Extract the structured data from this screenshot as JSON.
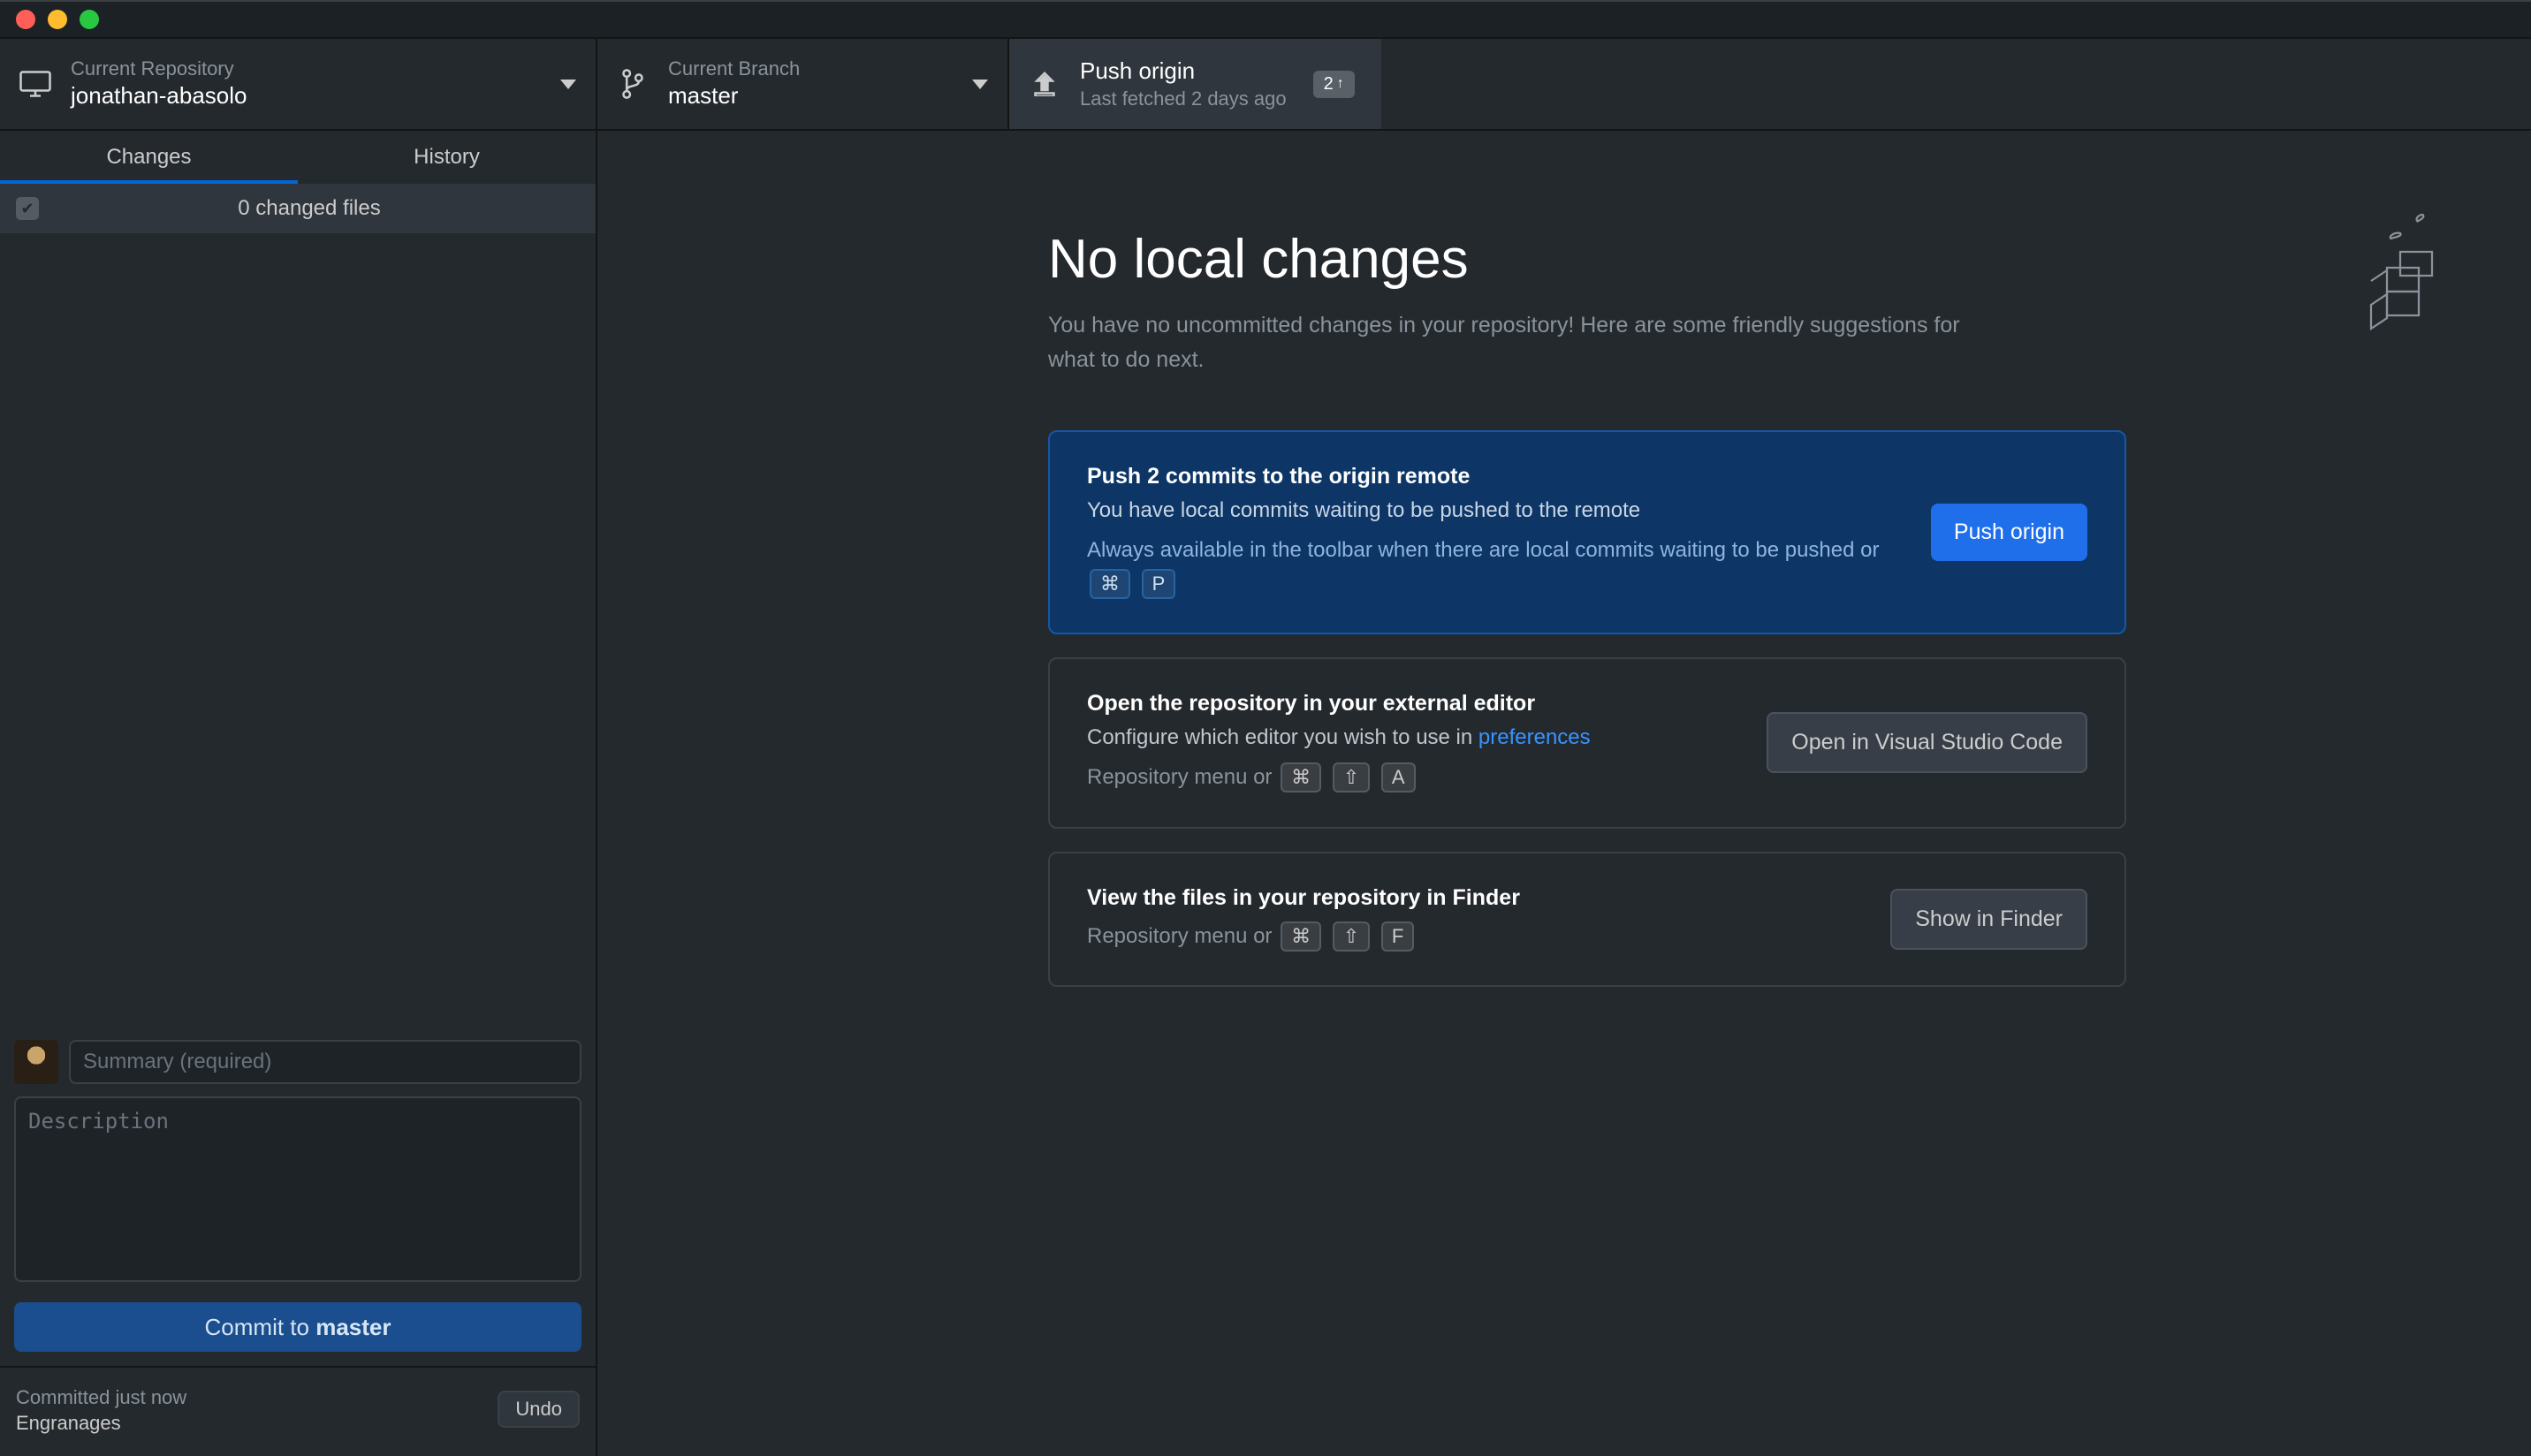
{
  "toolbar": {
    "repo_label": "Current Repository",
    "repo_name": "jonathan-abasolo",
    "branch_label": "Current Branch",
    "branch_name": "master",
    "push_label": "Push origin",
    "push_sub": "Last fetched 2 days ago",
    "push_badge_count": "2"
  },
  "sidebar": {
    "tab_changes": "Changes",
    "tab_history": "History",
    "changed_files": "0 changed files",
    "summary_placeholder": "Summary (required)",
    "description_placeholder": "Description",
    "commit_prefix": "Commit to ",
    "commit_branch": "master",
    "undo_line1": "Committed just now",
    "undo_line2": "Engranages",
    "undo_btn": "Undo"
  },
  "content": {
    "hero_title": "No local changes",
    "hero_sub": "You have no uncommitted changes in your repository! Here are some friendly suggestions for what to do next.",
    "cards": [
      {
        "title": "Push 2 commits to the origin remote",
        "line": "You have local commits waiting to be pushed to the remote",
        "hint_pre": "Always available in the toolbar when there are local commits waiting to be pushed or ",
        "kbd1": "⌘",
        "kbd2": "P",
        "button": "Push origin"
      },
      {
        "title": "Open the repository in your external editor",
        "line_pre": "Configure which editor you wish to use in ",
        "line_link": "preferences",
        "hint_pre": "Repository menu or ",
        "kbd1": "⌘",
        "kbd2": "⇧",
        "kbd3": "A",
        "button": "Open in Visual Studio Code"
      },
      {
        "title": "View the files in your repository in Finder",
        "hint_pre": "Repository menu or ",
        "kbd1": "⌘",
        "kbd2": "⇧",
        "kbd3": "F",
        "button": "Show in Finder"
      }
    ]
  }
}
